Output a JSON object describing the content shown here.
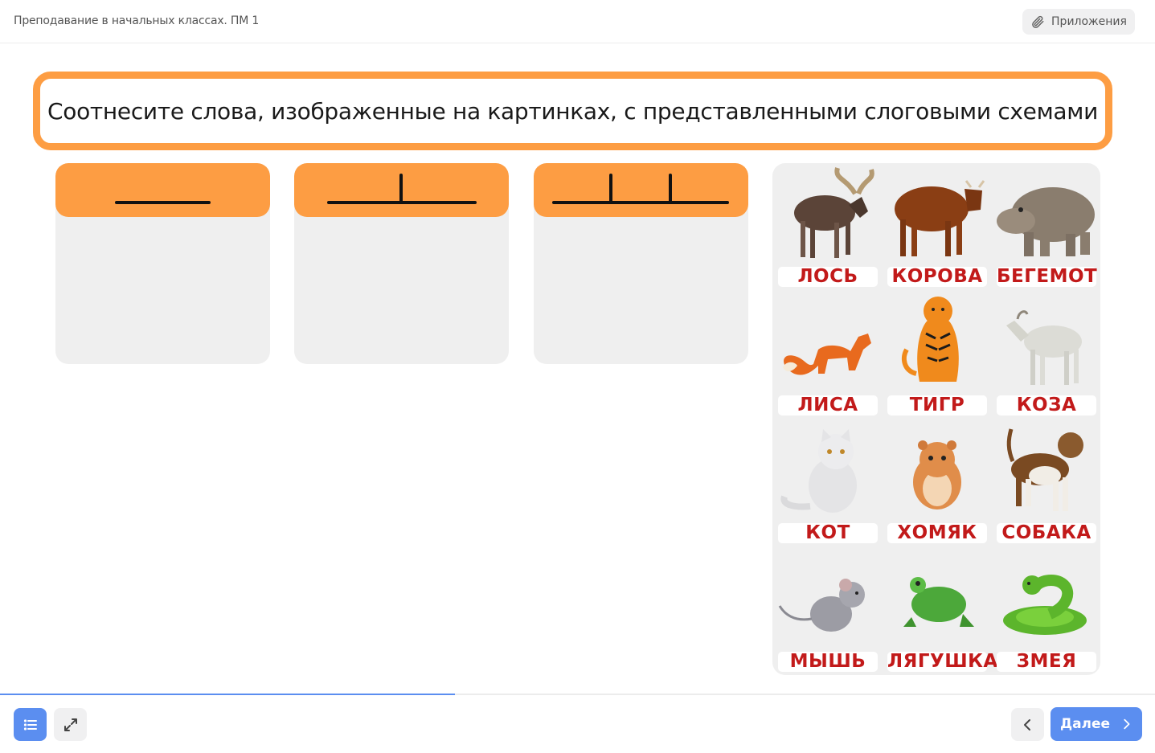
{
  "header": {
    "title": "Преподавание в начальных классах. ПМ 1",
    "attachments_label": "Приложения"
  },
  "task": {
    "instruction": "Соотнесите слова, изображенные на картинках, с представленными слоговыми схемами"
  },
  "schemes": [
    {
      "syllables": 1
    },
    {
      "syllables": 2
    },
    {
      "syllables": 3
    }
  ],
  "cards": [
    {
      "word": "ЛОСЬ",
      "icon": "moose-icon"
    },
    {
      "word": "КОРОВА",
      "icon": "cow-icon"
    },
    {
      "word": "БЕГЕМОТ",
      "icon": "hippo-icon"
    },
    {
      "word": "ЛИСА",
      "icon": "fox-icon"
    },
    {
      "word": "ТИГР",
      "icon": "tiger-icon"
    },
    {
      "word": "КОЗА",
      "icon": "goat-icon"
    },
    {
      "word": "КОТ",
      "icon": "cat-icon"
    },
    {
      "word": "ХОМЯК",
      "icon": "hamster-icon"
    },
    {
      "word": "СОБАКА",
      "icon": "dog-icon"
    },
    {
      "word": "МЫШЬ",
      "icon": "mouse-icon"
    },
    {
      "word": "ЛЯГУШКА",
      "icon": "frog-icon"
    },
    {
      "word": "ЗМЕЯ",
      "icon": "snake-icon"
    }
  ],
  "footer": {
    "progress": 0.394,
    "next_label": "Далее"
  },
  "colors": {
    "accent": "#fd9d43",
    "primary": "#5b8ef0",
    "label_red": "#c21a1a",
    "panel_bg": "#efefef"
  }
}
